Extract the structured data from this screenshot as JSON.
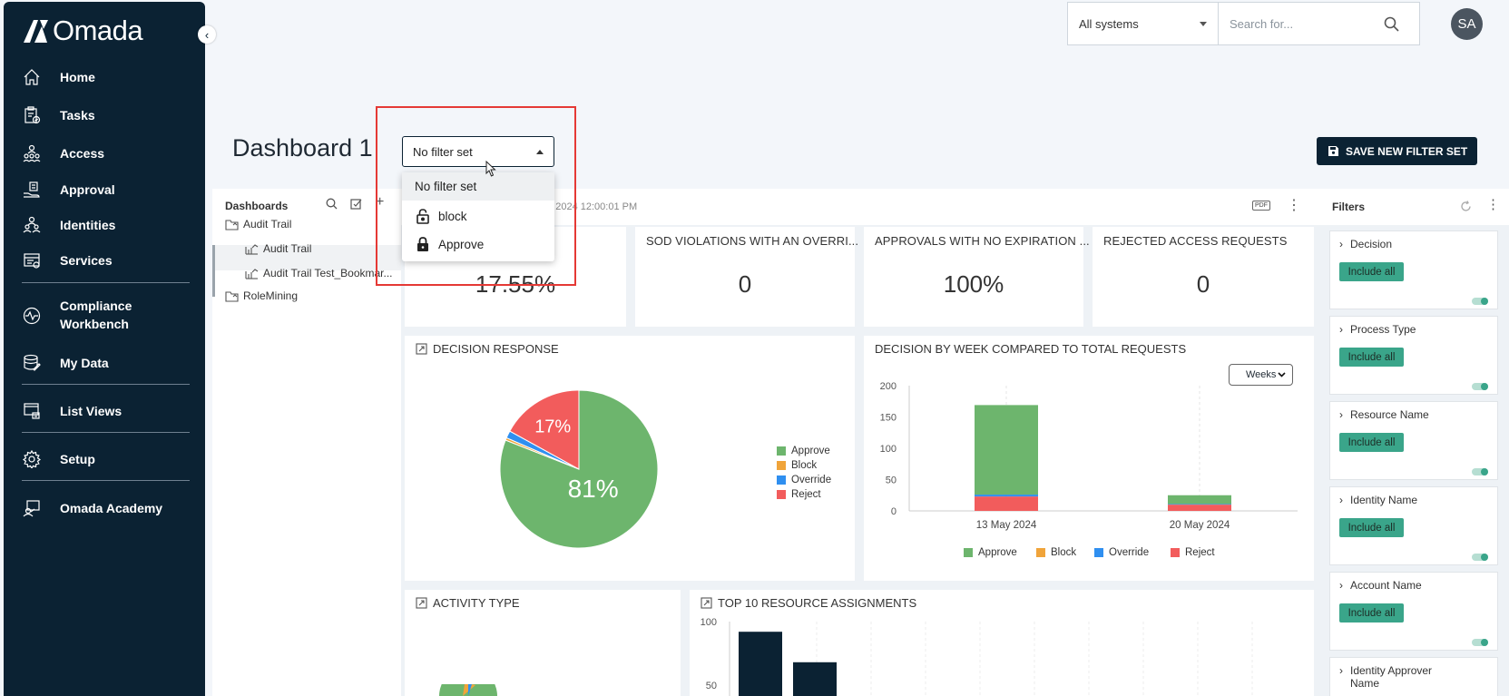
{
  "app": {
    "brand": "Omada",
    "colors": {
      "sidebar": "#0b2233",
      "accent": "#3aa58a",
      "approve": "#6db56d",
      "block": "#f0a43a",
      "override": "#2f8ff0",
      "reject": "#f25c5c",
      "bar_dark": "#0b2233"
    }
  },
  "sidebar": {
    "items": [
      {
        "label": "Home",
        "icon": "home-icon"
      },
      {
        "label": "Tasks",
        "icon": "tasks-icon"
      },
      {
        "label": "Access",
        "icon": "access-icon"
      },
      {
        "label": "Approval",
        "icon": "approval-icon"
      },
      {
        "label": "Identities",
        "icon": "identities-icon"
      },
      {
        "label": "Services",
        "icon": "services-icon"
      },
      {
        "label": "Compliance Workbench",
        "line1": "Compliance",
        "line2": "Workbench",
        "icon": "compliance-icon"
      },
      {
        "label": "My Data",
        "icon": "database-icon"
      },
      {
        "label": "List Views",
        "icon": "list-views-icon"
      },
      {
        "label": "Setup",
        "icon": "gear-icon"
      },
      {
        "label": "Omada Academy",
        "icon": "academy-icon"
      }
    ]
  },
  "topbar": {
    "system_select": "All systems",
    "search_placeholder": "Search for...",
    "avatar_initials": "SA"
  },
  "header": {
    "title": "Dashboard 1",
    "filter_select": "No filter set",
    "filter_options": [
      {
        "label": "No filter set",
        "selected": true
      },
      {
        "label": "block",
        "icon": "unlocked-icon"
      },
      {
        "label": "Approve",
        "icon": "locked-icon"
      }
    ],
    "save_button": "SAVE NEW FILTER SET"
  },
  "dashboards_panel": {
    "title": "Dashboards",
    "tree": [
      {
        "label": "Audit Trail",
        "level": 0
      },
      {
        "label": "Audit Trail",
        "level": 1,
        "selected": true
      },
      {
        "label": "Audit Trail Test_Bookmar...",
        "level": 1
      },
      {
        "label": "RoleMining",
        "level": 0
      }
    ]
  },
  "date_range": "0, 2024 12:00:01 PM",
  "kpis": [
    {
      "title": "",
      "value": "17.55%"
    },
    {
      "title": "SOD VIOLATIONS WITH AN OVERRI...",
      "value": "0"
    },
    {
      "title": "APPROVALS WITH NO EXPIRATION ...",
      "value": "100%"
    },
    {
      "title": "REJECTED ACCESS REQUESTS",
      "value": "0"
    }
  ],
  "panels": {
    "decision_response": "DECISION RESPONSE",
    "decision_by_week": "DECISION BY WEEK COMPARED TO TOTAL REQUESTS",
    "weeks_select": "Weeks",
    "activity_type": "ACTIVITY TYPE",
    "top10": "TOP 10 RESOURCE ASSIGNMENTS"
  },
  "chart_data": [
    {
      "type": "pie",
      "title": "DECISION RESPONSE",
      "slices": [
        {
          "name": "Approve",
          "value": 81,
          "label": "81%"
        },
        {
          "name": "Block",
          "value": 0.5,
          "label": ""
        },
        {
          "name": "Override",
          "value": 1.5,
          "label": ""
        },
        {
          "name": "Reject",
          "value": 17,
          "label": "17%"
        }
      ],
      "legend": [
        "Approve",
        "Block",
        "Override",
        "Reject"
      ],
      "legend_position": "right"
    },
    {
      "type": "bar",
      "stacked": true,
      "title": "DECISION BY WEEK COMPARED TO TOTAL REQUESTS",
      "categories": [
        "13 May 2024",
        "20 May 2024"
      ],
      "series": [
        {
          "name": "Approve",
          "values": [
            143,
            14
          ]
        },
        {
          "name": "Block",
          "values": [
            0,
            0
          ]
        },
        {
          "name": "Override",
          "values": [
            3,
            1
          ]
        },
        {
          "name": "Reject",
          "values": [
            23,
            10
          ]
        }
      ],
      "yticks": [
        0,
        50,
        100,
        150,
        200
      ],
      "ylim": [
        0,
        200
      ],
      "legend_position": "bottom"
    },
    {
      "type": "bar",
      "title": "TOP 10 RESOURCE ASSIGNMENTS",
      "categories": [
        "",
        ""
      ],
      "values": [
        92,
        68
      ],
      "yticks": [
        50,
        100
      ],
      "ylim": [
        0,
        100
      ]
    }
  ],
  "filters": {
    "title": "Filters",
    "items": [
      {
        "name": "Decision",
        "button": "Include all"
      },
      {
        "name": "Process Type",
        "button": "Include all"
      },
      {
        "name": "Resource Name",
        "button": "Include all"
      },
      {
        "name": "Identity Name",
        "button": "Include all"
      },
      {
        "name": "Account Name",
        "button": "Include all"
      },
      {
        "name": "Identity Approver Name",
        "line1": "Identity Approver",
        "line2": "Name"
      }
    ]
  }
}
